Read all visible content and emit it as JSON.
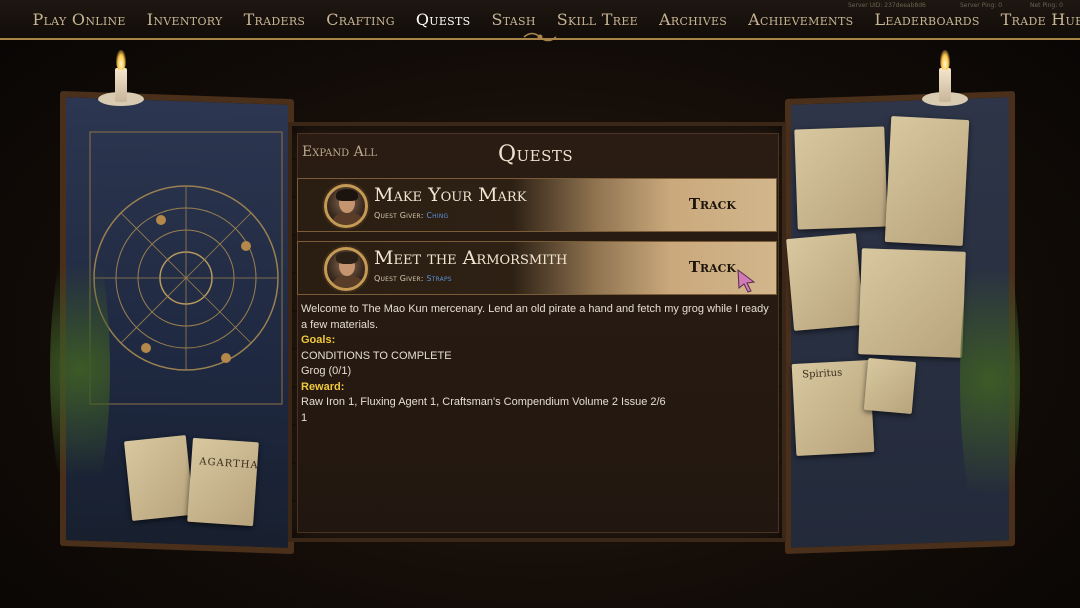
{
  "nav": {
    "items": [
      "Play Online",
      "Inventory",
      "Traders",
      "Crafting",
      "Quests",
      "Stash",
      "Skill Tree",
      "Archives",
      "Achievements",
      "Leaderboards",
      "Trade Hub"
    ],
    "active": "Quests",
    "server_uid": "Server UID: 237deeab8d6",
    "server_ping": "Server Ping: 0",
    "net_ping": "Net Ping: 0"
  },
  "board": {
    "expand_all_label": "Expand All",
    "title": "Quests"
  },
  "quests": [
    {
      "name": "Make Your Mark",
      "giver_label": "Quest Giver:",
      "giver": "Ching",
      "track_label": "Track"
    },
    {
      "name": "Meet the Armorsmith",
      "giver_label": "Quest Giver:",
      "giver": "Straps",
      "track_label": "Track"
    }
  ],
  "details": {
    "description": "Welcome to The Mao Kun mercenary. Lend an old pirate a hand and fetch my grog while I ready a few materials.",
    "goals_label": "Goals:",
    "conditions": "CONDITIONS TO COMPLETE",
    "goal_item": "Grog (0/1)",
    "reward_label": "Reward:",
    "reward": "Raw Iron 1, Fluxing Agent 1, Craftsman's Compendium Volume 2 Issue 2/6",
    "reward_extra": "1"
  },
  "decor": {
    "left_paper_label": "AGARTHA",
    "right_paper_label": "Spiritus"
  },
  "colors": {
    "accent_gold": "#a9854a",
    "label_yellow": "#f0c83c",
    "giver_blue": "#5b8fd6"
  }
}
